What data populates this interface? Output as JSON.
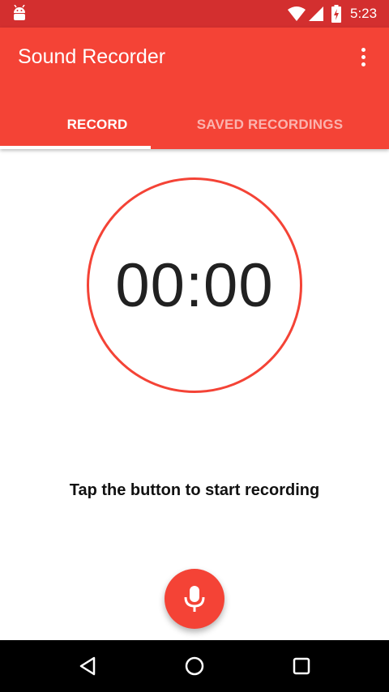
{
  "status_bar": {
    "time": "5:23",
    "icons": [
      "android-icon",
      "wifi-icon",
      "signal-icon",
      "battery-charging-icon"
    ]
  },
  "app_bar": {
    "title": "Sound Recorder",
    "overflow_icon": "more-vert-icon"
  },
  "tabs": [
    {
      "label": "RECORD",
      "selected": true
    },
    {
      "label": "SAVED RECORDINGS",
      "selected": false
    }
  ],
  "timer": {
    "value": "00:00"
  },
  "hint_text": "Tap the button to start recording",
  "record_button": {
    "icon": "microphone-icon"
  },
  "navigation": {
    "icons": [
      "back-icon",
      "home-icon",
      "recents-icon"
    ]
  },
  "colors": {
    "status_bar": "#d32f2f",
    "primary": "#f44336",
    "text": "#212121",
    "nav_bar": "#000000"
  }
}
